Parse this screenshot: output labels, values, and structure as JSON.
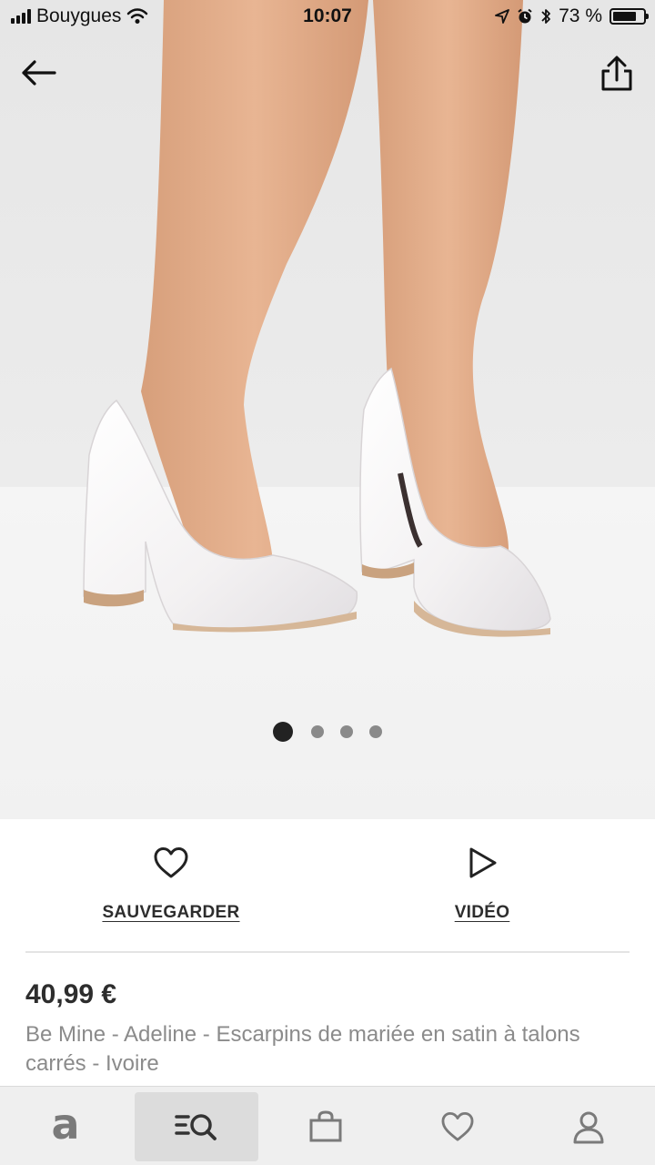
{
  "status_bar": {
    "carrier": "Bouygues",
    "time": "10:07",
    "battery_text": "73 %",
    "battery_level": 0.73
  },
  "nav": {
    "back_icon": "arrow-left-icon",
    "share_icon": "share-icon"
  },
  "carousel": {
    "total": 4,
    "active_index": 0
  },
  "actions": {
    "save_label": "SAUVEGARDER",
    "save_icon": "heart-outline-icon",
    "video_label": "VIDÉO",
    "video_icon": "play-outline-icon"
  },
  "product": {
    "price": "40,99 €",
    "title": "Be Mine - Adeline - Escarpins de mariée en satin à talons carrés - Ivoire"
  },
  "tabbar": {
    "items": [
      {
        "icon": "home-logo-icon",
        "glyph": "a"
      },
      {
        "icon": "search-icon",
        "active": true
      },
      {
        "icon": "bag-icon"
      },
      {
        "icon": "heart-icon"
      },
      {
        "icon": "account-icon"
      }
    ]
  },
  "colors": {
    "text": "#2d2d2d",
    "muted": "#8b8b8b",
    "tabbar_bg": "#efefef",
    "tab_active": "#dcdcdc",
    "icon_gray": "#7a7a7a"
  }
}
